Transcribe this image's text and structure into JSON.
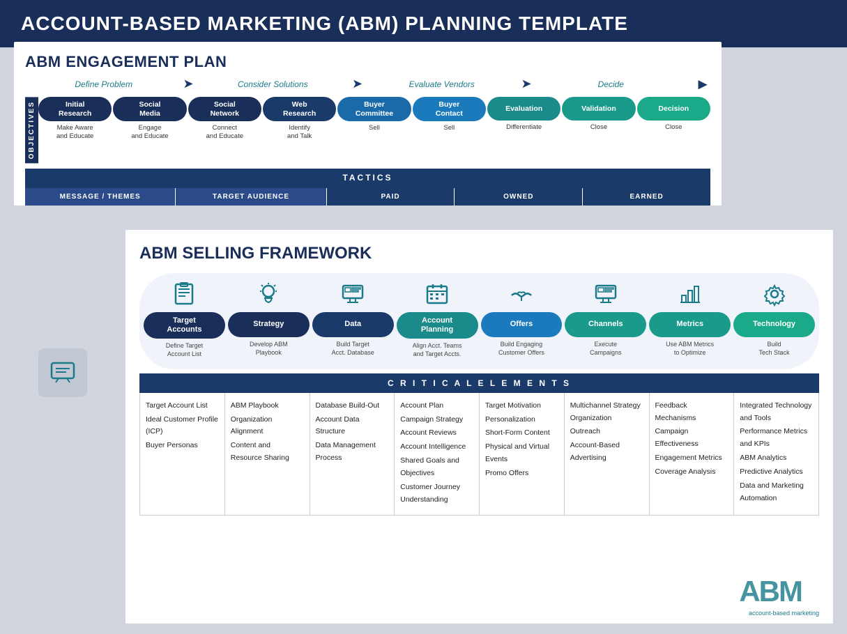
{
  "title": "ACCOUNT-BASED MARKETING (ABM) PLANNING TEMPLATE",
  "engagement": {
    "section_title": "ABM ENGAGEMENT PLAN",
    "journey_steps": [
      "Define Problem",
      "Consider Solutions",
      "Evaluate Vendors",
      "Decide"
    ],
    "objectives_label": "OBJECTIVES",
    "stages": [
      {
        "label": "Initial\nResearch",
        "sub": "Make Aware\nand Educate",
        "color": "#1a2e5a"
      },
      {
        "label": "Social\nMedia",
        "sub": "Engage\nand Educate",
        "color": "#1a2e5a"
      },
      {
        "label": "Social\nNetwork",
        "sub": "Connect\nand Educate",
        "color": "#1a2e5a"
      },
      {
        "label": "Web\nResearch",
        "sub": "Identify\nand Talk",
        "color": "#1a3a6a"
      },
      {
        "label": "Buyer\nCommittee",
        "sub": "Sell",
        "color": "#1a6aaa"
      },
      {
        "label": "Buyer\nContact",
        "sub": "Sell",
        "color": "#1a7abc"
      },
      {
        "label": "Evaluation",
        "sub": "Differentiate",
        "color": "#1a8a8a"
      },
      {
        "label": "Validation",
        "sub": "Close",
        "color": "#1a9a8a"
      },
      {
        "label": "Decision",
        "sub": "Close",
        "color": "#1aaa8a"
      }
    ],
    "tactics_label": "TACTICS",
    "table_headers": [
      "MESSAGE / THEMES",
      "TARGET AUDIENCE",
      "PAID",
      "OWNED",
      "EARNED"
    ]
  },
  "selling": {
    "section_title": "ABM SELLING FRAMEWORK",
    "columns": [
      {
        "icon": "📋",
        "label": "Target\nAccounts",
        "sub": "Define Target\nAccount List",
        "color": "#1a2e5a",
        "critical": [
          "Target Account List",
          "Ideal Customer Profile (ICP)",
          "Buyer Personas"
        ]
      },
      {
        "icon": "💡",
        "label": "Strategy",
        "sub": "Develop ABM\nPlaybook",
        "color": "#1a2e5a",
        "critical": [
          "ABM Playbook",
          "Organization Alignment",
          "Content and Resource Sharing"
        ]
      },
      {
        "icon": "🖥",
        "label": "Data",
        "sub": "Build Target\nAcct. Database",
        "color": "#1a3a6a",
        "critical": [
          "Database Build-Out",
          "Account Data Structure",
          "Data Management Process"
        ]
      },
      {
        "icon": "📅",
        "label": "Account\nPlanning",
        "sub": "Align Acct. Teams\nand Target Accts.",
        "color": "#1a8a8a",
        "critical": [
          "Account Plan",
          "Campaign Strategy",
          "Account Reviews",
          "Account Intelligence",
          "Shared Goals and Objectives",
          "Customer Journey Understanding"
        ]
      },
      {
        "icon": "🤝",
        "label": "Offers",
        "sub": "Build Engaging\nCustomer Offers",
        "color": "#1a7abc",
        "critical": [
          "Target Motivation",
          "Personalization",
          "Short-Form Content",
          "Physical and Virtual Events",
          "Promo Offers"
        ]
      },
      {
        "icon": "🖥",
        "label": "Channels",
        "sub": "Execute\nCampaigns",
        "color": "#1a9a8a",
        "critical": [
          "Multichannel Strategy Organization",
          "Outreach",
          "Account-Based Advertising"
        ]
      },
      {
        "icon": "📊",
        "label": "Metrics",
        "sub": "Use ABM Metrics\nto Optimize",
        "color": "#1a9a8a",
        "critical": [
          "Feedback Mechanisms",
          "Campaign Effectiveness",
          "Engagement Metrics",
          "Coverage Analysis"
        ]
      },
      {
        "icon": "⚙",
        "label": "Technology",
        "sub": "Build\nTech Stack",
        "color": "#1aaa8a",
        "critical": [
          "Integrated Technology and Tools",
          "Performance Metrics and KPIs",
          "ABM Analytics",
          "Predictive Analytics",
          "Data and Marketing Automation"
        ]
      }
    ],
    "critical_label": "C R I T I C A L   E L E M E N T S",
    "watermark": "ABM",
    "watermark_sub": "account-based marketing"
  }
}
